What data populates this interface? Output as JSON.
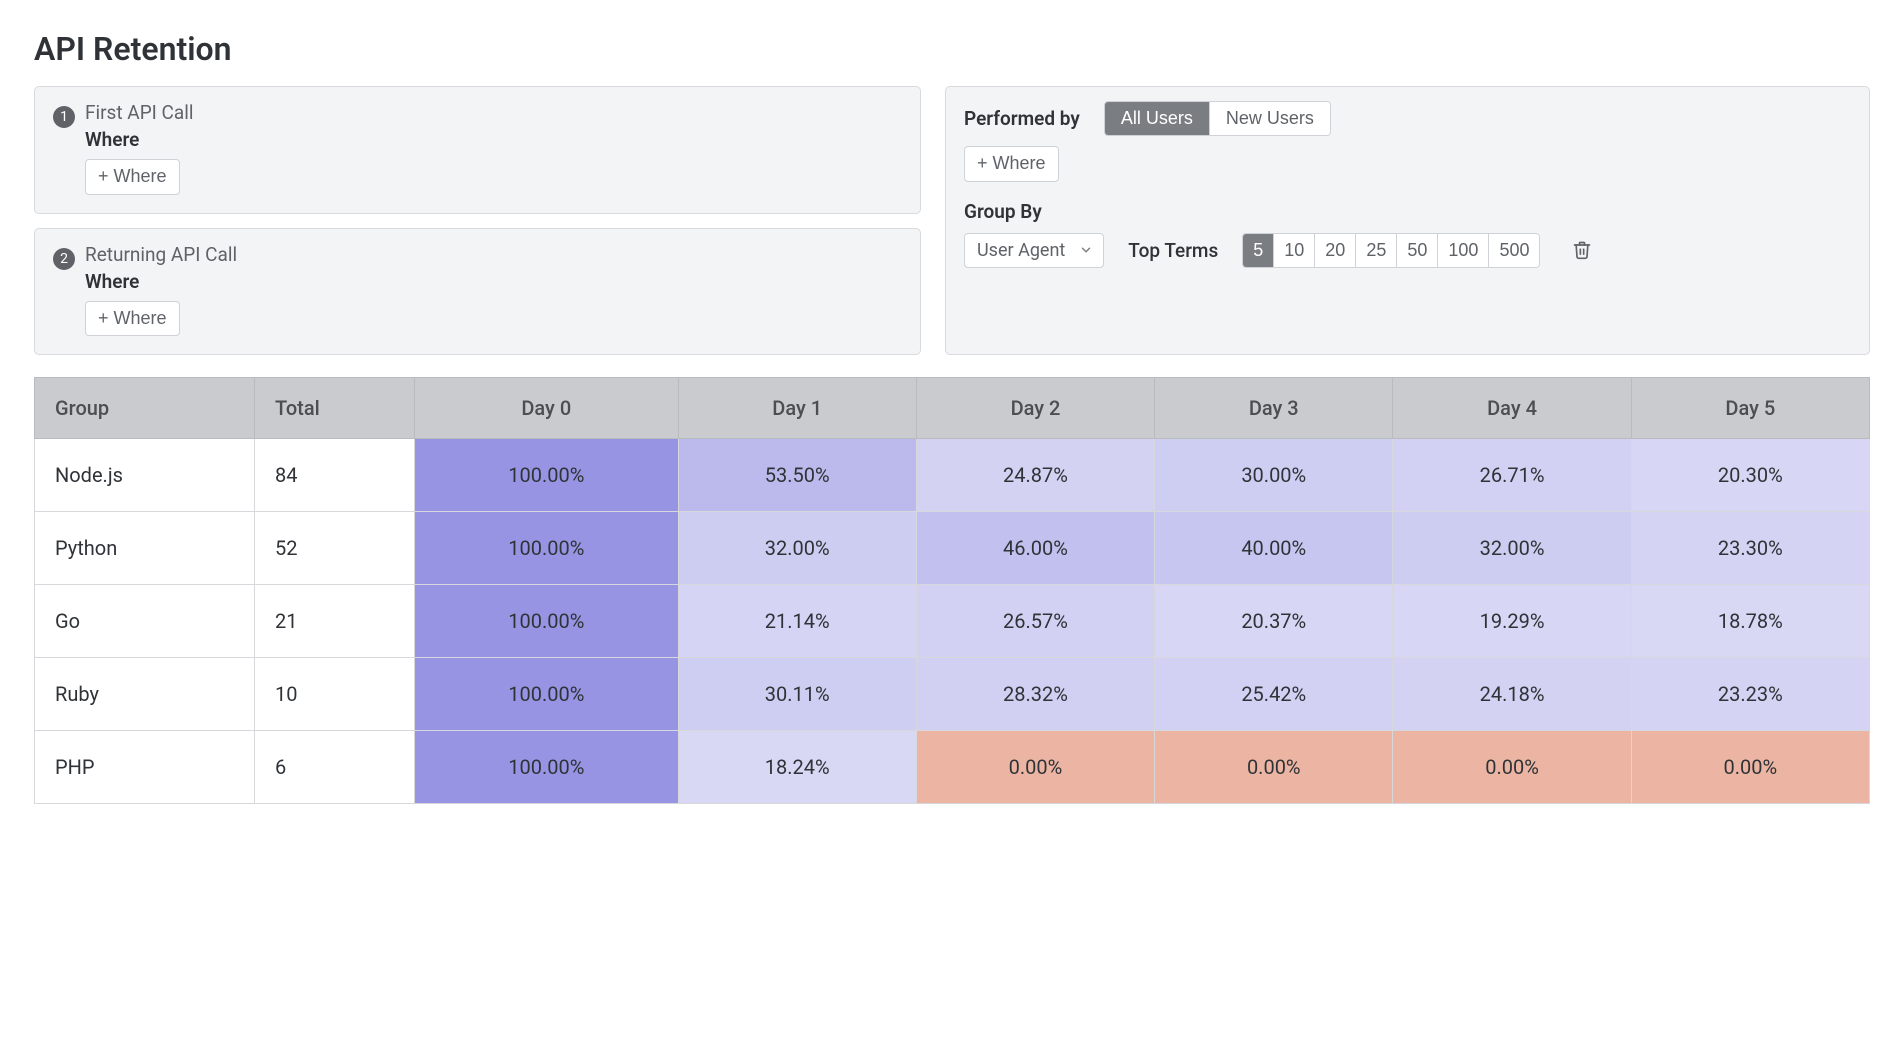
{
  "title": "API Retention",
  "steps": [
    {
      "number": "1",
      "label": "First API Call",
      "where_label": "Where",
      "add_where": "+ Where"
    },
    {
      "number": "2",
      "label": "Returning API Call",
      "where_label": "Where",
      "add_where": "+ Where"
    }
  ],
  "performed_by": {
    "label": "Performed by",
    "options": [
      "All Users",
      "New Users"
    ],
    "selected": "All Users",
    "add_where": "+ Where"
  },
  "group_by": {
    "label": "Group By",
    "field": "User Agent",
    "top_terms_label": "Top Terms",
    "top_terms_options": [
      "5",
      "10",
      "20",
      "25",
      "50",
      "100",
      "500"
    ],
    "top_terms_selected": "5"
  },
  "colors": {
    "heat_base_rgb": "133,130,222",
    "zero": "#ecb5a3"
  },
  "table": {
    "headers": [
      "Group",
      "Total",
      "Day 0",
      "Day 1",
      "Day 2",
      "Day 3",
      "Day 4",
      "Day 5"
    ],
    "rows": [
      {
        "group": "Node.js",
        "total": 84,
        "days": [
          100.0,
          53.5,
          24.87,
          30.0,
          26.71,
          20.3
        ]
      },
      {
        "group": "Python",
        "total": 52,
        "days": [
          100.0,
          32.0,
          46.0,
          40.0,
          32.0,
          23.3
        ]
      },
      {
        "group": "Go",
        "total": 21,
        "days": [
          100.0,
          21.14,
          26.57,
          20.37,
          19.29,
          18.78
        ]
      },
      {
        "group": "Ruby",
        "total": 10,
        "days": [
          100.0,
          30.11,
          28.32,
          25.42,
          24.18,
          23.23
        ]
      },
      {
        "group": "PHP",
        "total": 6,
        "days": [
          100.0,
          18.24,
          0.0,
          0.0,
          0.0,
          0.0
        ]
      }
    ]
  }
}
